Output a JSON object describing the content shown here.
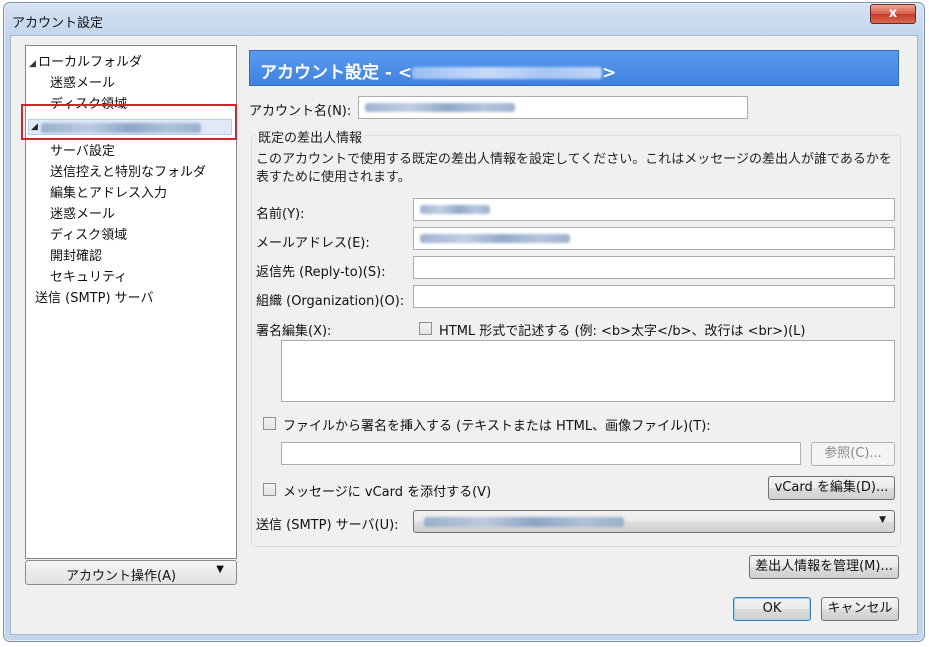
{
  "window": {
    "title": "アカウント設定",
    "close_glyph": "x"
  },
  "tree": {
    "root_label": "ローカルフォルダ",
    "local_children": [
      "迷惑メール",
      "ディスク領域"
    ],
    "account_children": [
      "サーバ設定",
      "送信控えと特別なフォルダ",
      "編集とアドレス入力",
      "迷惑メール",
      "ディスク領域",
      "開封確認",
      "セキュリティ"
    ],
    "smtp_label": "送信 (SMTP) サーバ"
  },
  "account_actions_label": "アカウント操作(A)",
  "header": {
    "title_prefix": "アカウント設定 - <",
    "title_suffix": ">"
  },
  "fields": {
    "account_name_label": "アカウント名(N):",
    "identity_group": "既定の差出人情報",
    "identity_desc": "このアカウントで使用する既定の差出人情報を設定してください。これはメッセージの差出人が誰であるかを表すために使用されます。",
    "name_label": "名前(Y):",
    "email_label": "メールアドレス(E):",
    "reply_to_label": "返信先 (Reply-to)(S):",
    "org_label": "組織 (Organization)(O):",
    "signature_label": "署名編集(X):",
    "html_check_label": "HTML 形式で記述する (例: <b>太字</b>、改行は <br>)(L)",
    "file_sig_label": "ファイルから署名を挿入する (テキストまたは HTML、画像ファイル)(T):",
    "browse_label": "参照(C)...",
    "vcard_check_label": "メッセージに vCard を添付する(V)",
    "vcard_edit_label": "vCard を編集(D)...",
    "smtp_label": "送信 (SMTP) サーバ(U):",
    "manage_ids_label": "差出人情報を管理(M)..."
  },
  "dialog": {
    "ok_label": "OK",
    "cancel_label": "キャンセル"
  },
  "icons": {
    "tree_expanded": "◢",
    "dropdown": "▼"
  },
  "colors": {
    "header_blue": "#4a8ce8",
    "highlight_red": "#d2262e"
  }
}
